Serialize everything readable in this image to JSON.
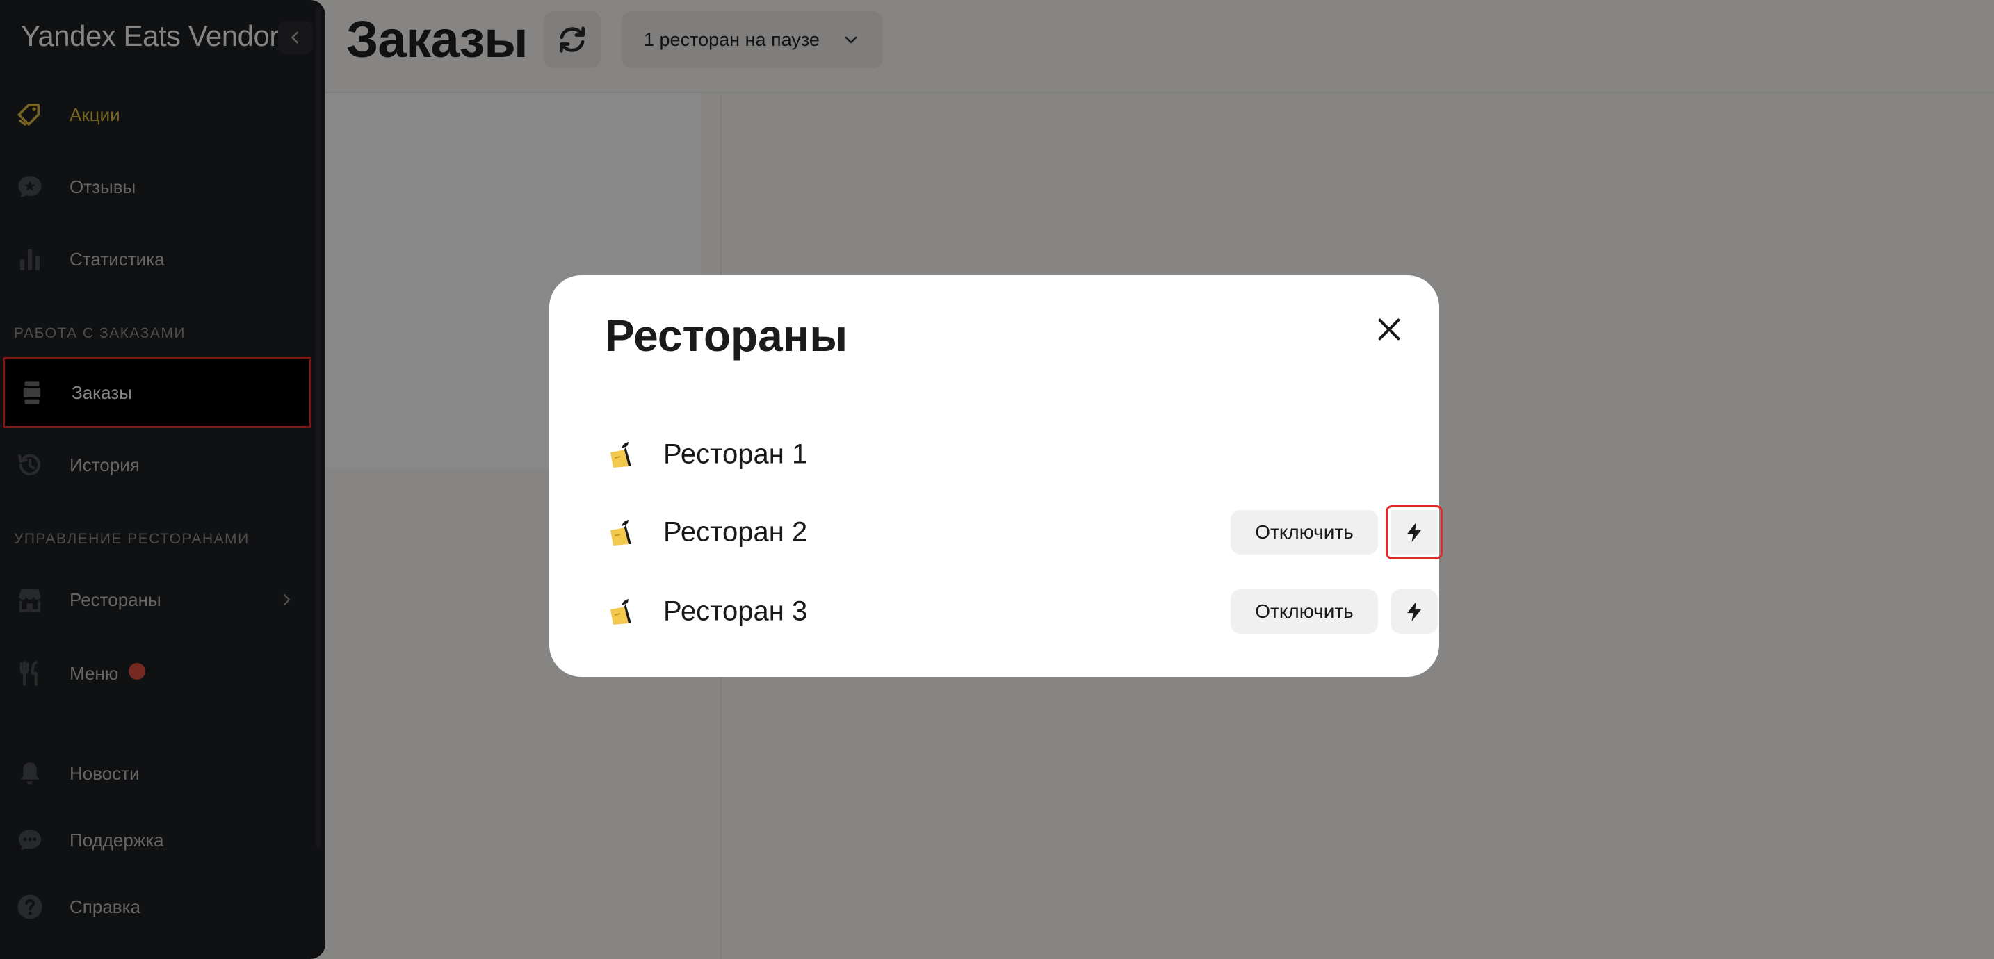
{
  "sidebar": {
    "brand": "Yandex Eats Vendor",
    "items_top": [
      {
        "label": "Акции",
        "icon": "tag-icon"
      },
      {
        "label": "Отзывы",
        "icon": "review-star-icon"
      },
      {
        "label": "Статистика",
        "icon": "bar-chart-icon"
      }
    ],
    "section_orders": "РАБОТА С ЗАКАЗАМИ",
    "items_orders": [
      {
        "label": "Заказы",
        "icon": "orders-icon"
      },
      {
        "label": "История",
        "icon": "history-icon"
      }
    ],
    "section_restaurants": "УПРАВЛЕНИЕ РЕСТОРАНАМИ",
    "items_restaurants": [
      {
        "label": "Рестораны",
        "icon": "store-icon"
      },
      {
        "label": "Меню",
        "icon": "fork-knife-icon"
      }
    ],
    "items_bottom": [
      {
        "label": "Новости",
        "icon": "bell-icon"
      },
      {
        "label": "Поддержка",
        "icon": "chat-icon"
      },
      {
        "label": "Справка",
        "icon": "help-icon"
      }
    ]
  },
  "header": {
    "title": "Заказы",
    "pause_dropdown": "1 ресторан на паузе"
  },
  "modal": {
    "title": "Рестораны",
    "restaurants": [
      {
        "name": "Ресторан 1",
        "disable_label": ""
      },
      {
        "name": "Ресторан 2",
        "disable_label": "Отключить"
      },
      {
        "name": "Ресторан 3",
        "disable_label": "Отключить"
      }
    ]
  },
  "colors": {
    "accent": "#d8b842",
    "sidebar_bg": "#1e1f22",
    "highlight": "#e02a2a",
    "badge": "#d64b3b"
  }
}
